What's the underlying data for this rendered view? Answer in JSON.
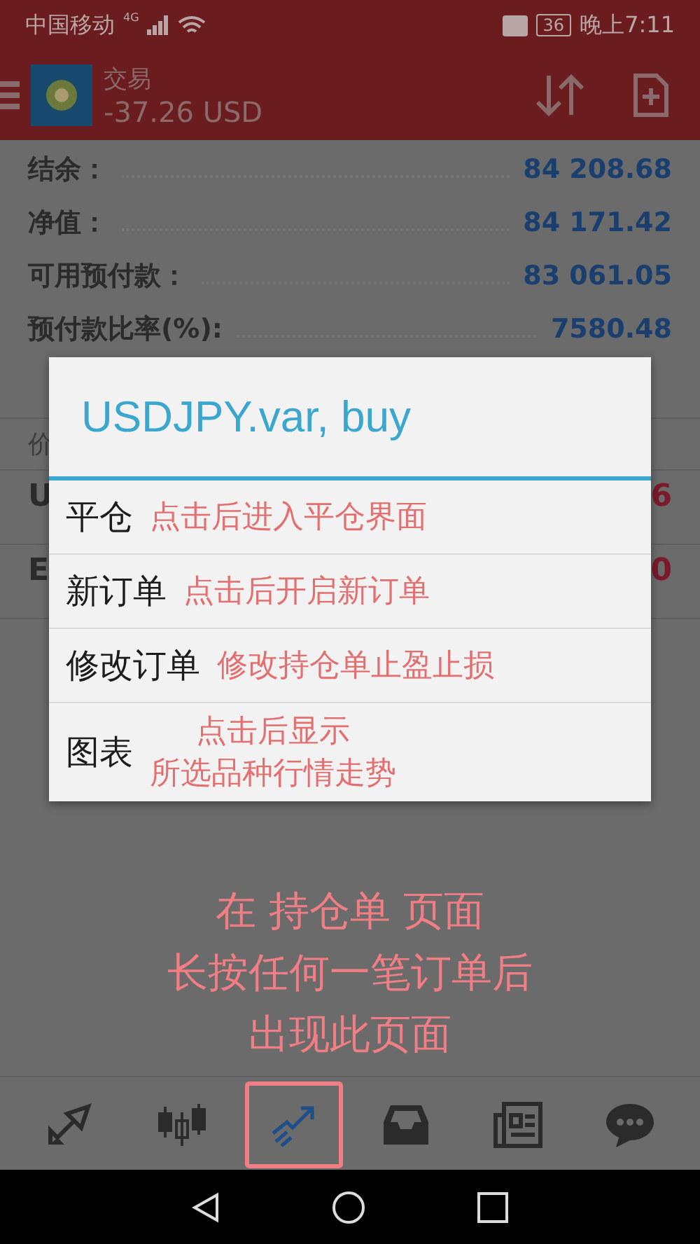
{
  "status_bar": {
    "carrier": "中国移动",
    "network": "4G",
    "battery": "36",
    "time": "晚上7:11"
  },
  "app_bar": {
    "title": "交易",
    "balance": "-37.26 USD"
  },
  "account_rows": [
    {
      "label": "结余：",
      "value": "84 208.68"
    },
    {
      "label": "净值：",
      "value": "84 171.42"
    },
    {
      "label": "可用预付款：",
      "value": "83 061.05"
    },
    {
      "label": "预付款比率(%):",
      "value": "7580.48"
    }
  ],
  "section_header": "价",
  "positions": [
    {
      "symbol": "U",
      "value": "6"
    },
    {
      "symbol": "E",
      "value": "0"
    }
  ],
  "dialog": {
    "title": "USDJPY.var, buy",
    "items": [
      {
        "label": "平仓",
        "note": [
          "点击后进入平仓界面"
        ]
      },
      {
        "label": "新订单",
        "note": [
          "点击后开启新订单"
        ]
      },
      {
        "label": "修改订单",
        "note": [
          "修改持仓单止盈止损"
        ]
      },
      {
        "label": "图表",
        "note": [
          "点击后显示",
          "所选品种行情走势"
        ]
      }
    ]
  },
  "instruction": [
    "在 持仓单 页面",
    "长按任何一笔订单后",
    "出现此页面"
  ],
  "bottom_tabs": [
    {
      "kind": "quotes",
      "selected": false
    },
    {
      "kind": "chart",
      "selected": false
    },
    {
      "kind": "trade",
      "selected": true
    },
    {
      "kind": "history",
      "selected": false
    },
    {
      "kind": "news",
      "selected": false
    },
    {
      "kind": "chat",
      "selected": false
    }
  ]
}
